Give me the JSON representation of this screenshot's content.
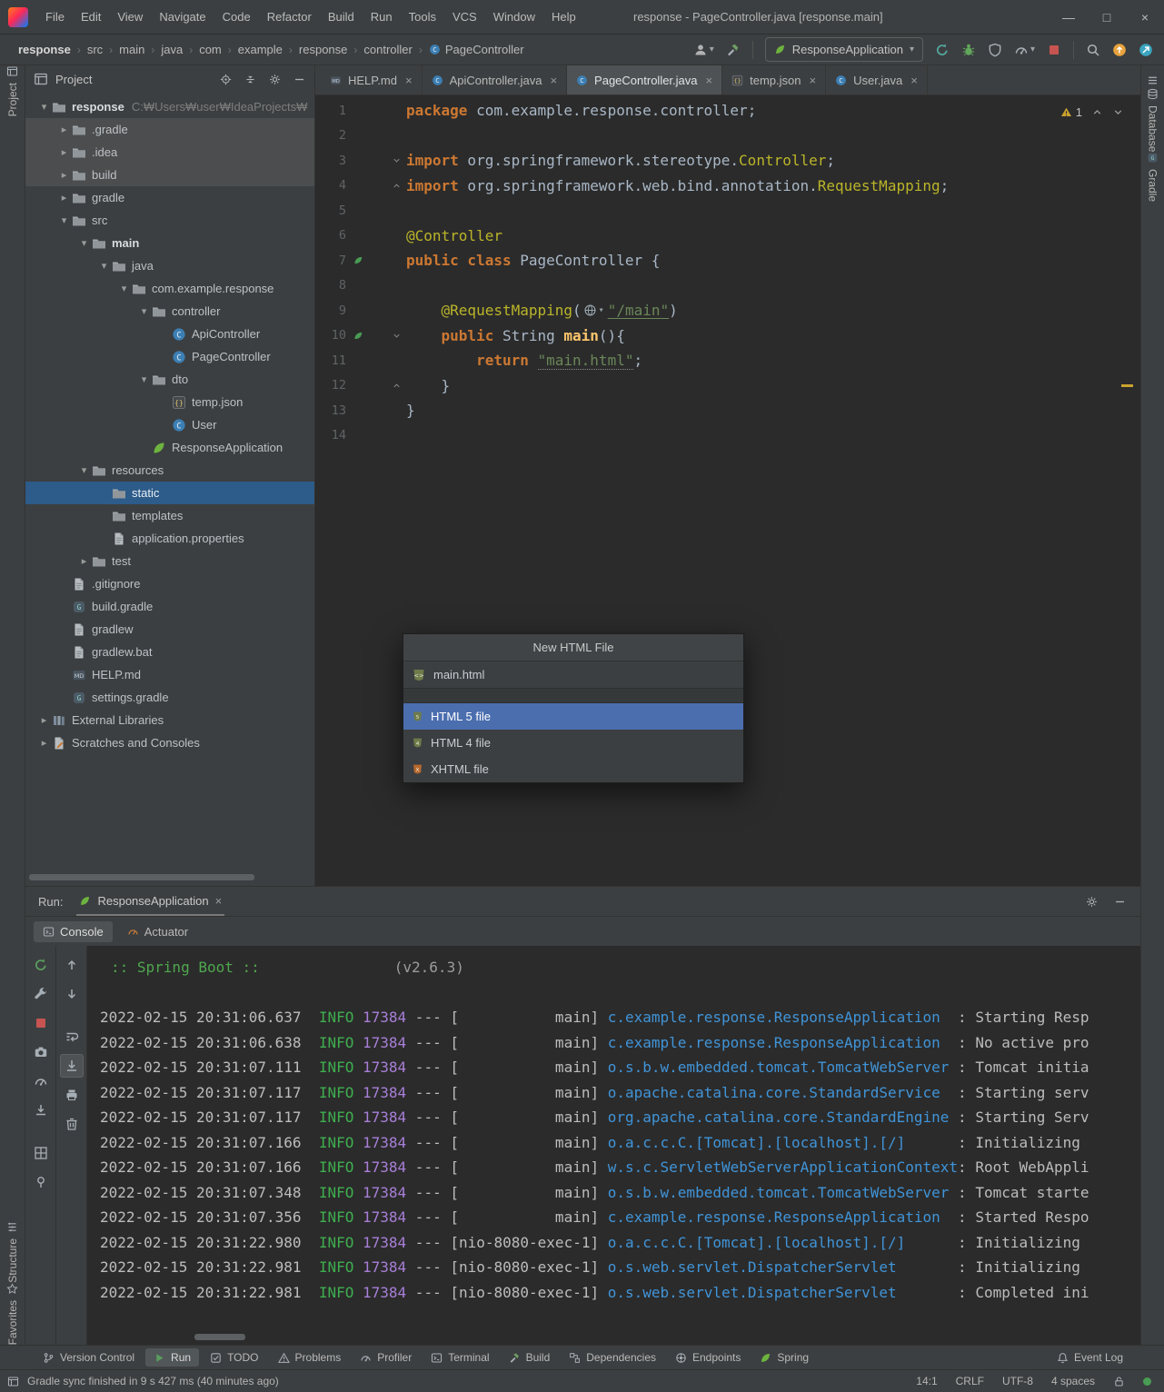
{
  "title_bar": {
    "menus": [
      "File",
      "Edit",
      "View",
      "Navigate",
      "Code",
      "Refactor",
      "Build",
      "Run",
      "Tools",
      "VCS",
      "Window",
      "Help"
    ],
    "title": "response - PageController.java [response.main]",
    "window_controls": {
      "minimize": "—",
      "maximize": "□",
      "close": "×"
    }
  },
  "nav_bar": {
    "breadcrumbs": [
      "response",
      "src",
      "main",
      "java",
      "com",
      "example",
      "response",
      "controller",
      "PageController"
    ],
    "left_actions": [
      {
        "icon": "user",
        "name": "user-menu",
        "chevron": true
      },
      {
        "icon": "hammer",
        "name": "build-project"
      }
    ],
    "run_config": {
      "icon": "spring",
      "label": "ResponseApplication"
    },
    "run_actions": [
      {
        "icon": "rerun",
        "name": "rerun-application"
      },
      {
        "icon": "bug",
        "name": "debug"
      },
      {
        "icon": "shield",
        "name": "run-with-coverage"
      },
      {
        "icon": "gauge",
        "name": "profiler",
        "chevron": true
      },
      {
        "icon": "stop",
        "name": "stop"
      }
    ],
    "far_actions": [
      {
        "icon": "search",
        "name": "search-everywhere"
      },
      {
        "icon": "circleUp",
        "name": "ide-update"
      },
      {
        "icon": "circleT",
        "name": "run-anything"
      }
    ]
  },
  "left_strip": {
    "top": [
      {
        "label": "Project",
        "icon": "projWin"
      }
    ],
    "bottom": [
      {
        "label": "Structure",
        "icon": "structure"
      },
      {
        "label": "Favorites",
        "icon": "star"
      }
    ]
  },
  "right_strip": {
    "top": [
      {
        "label": "Database",
        "icon": "db"
      },
      {
        "label": "Gradle",
        "icon": "gradleFile"
      }
    ]
  },
  "project_panel": {
    "title": "Project",
    "header_actions": [
      {
        "icon": "target",
        "name": "locate-file"
      },
      {
        "icon": "collapseAll",
        "name": "collapse-all"
      },
      {
        "icon": "gear",
        "name": "panel-settings"
      },
      {
        "icon": "minus",
        "name": "hide-panel"
      }
    ],
    "tree": [
      {
        "l": "response",
        "d": 0,
        "i": "folder",
        "a": "open",
        "bold": true,
        "extra": "C:₩Users₩user₩IdeaProjects₩"
      },
      {
        "l": ".gradle",
        "d": 1,
        "i": "folder",
        "a": "closed",
        "hl": true
      },
      {
        "l": ".idea",
        "d": 1,
        "i": "folder",
        "a": "closed",
        "hl": true
      },
      {
        "l": "build",
        "d": 1,
        "i": "folder",
        "a": "closed",
        "hl": true
      },
      {
        "l": "gradle",
        "d": 1,
        "i": "folder",
        "a": "closed"
      },
      {
        "l": "src",
        "d": 1,
        "i": "folder",
        "a": "open"
      },
      {
        "l": "main",
        "d": 2,
        "i": "folder",
        "a": "open",
        "bold": true
      },
      {
        "l": "java",
        "d": 3,
        "i": "folder",
        "a": "open"
      },
      {
        "l": "com.example.response",
        "d": 4,
        "i": "folder",
        "a": "open"
      },
      {
        "l": "controller",
        "d": 5,
        "i": "folder",
        "a": "open"
      },
      {
        "l": "ApiController",
        "d": 6,
        "i": "class"
      },
      {
        "l": "PageController",
        "d": 6,
        "i": "class"
      },
      {
        "l": "dto",
        "d": 5,
        "i": "folder",
        "a": "open"
      },
      {
        "l": "temp.json",
        "d": 6,
        "i": "json"
      },
      {
        "l": "User",
        "d": 6,
        "i": "class"
      },
      {
        "l": "ResponseApplication",
        "d": 5,
        "i": "spring"
      },
      {
        "l": "resources",
        "d": 2,
        "i": "folder",
        "a": "open"
      },
      {
        "l": "static",
        "d": 3,
        "i": "folder",
        "sel": true
      },
      {
        "l": "templates",
        "d": 3,
        "i": "folder"
      },
      {
        "l": "application.properties",
        "d": 3,
        "i": "file"
      },
      {
        "l": "test",
        "d": 2,
        "i": "folder",
        "a": "closed"
      },
      {
        "l": ".gitignore",
        "d": 1,
        "i": "file"
      },
      {
        "l": "build.gradle",
        "d": 1,
        "i": "gradleFile"
      },
      {
        "l": "gradlew",
        "d": 1,
        "i": "file"
      },
      {
        "l": "gradlew.bat",
        "d": 1,
        "i": "file"
      },
      {
        "l": "HELP.md",
        "d": 1,
        "i": "md"
      },
      {
        "l": "settings.gradle",
        "d": 1,
        "i": "gradleFile"
      },
      {
        "l": "External Libraries",
        "d": 0,
        "i": "lib",
        "a": "closed"
      },
      {
        "l": "Scratches and Consoles",
        "d": 0,
        "i": "scratch",
        "a": "closed"
      }
    ]
  },
  "editor": {
    "tabs": [
      {
        "label": "HELP.md",
        "icon": "md"
      },
      {
        "label": "ApiController.java",
        "icon": "class"
      },
      {
        "label": "PageController.java",
        "icon": "class",
        "active": true
      },
      {
        "label": "temp.json",
        "icon": "json"
      },
      {
        "label": "User.java",
        "icon": "class"
      }
    ],
    "warning_count": "1",
    "code": [
      {
        "n": 1,
        "t": [
          [
            "k",
            "package"
          ],
          [
            "p",
            " com.example.response.controller;"
          ]
        ]
      },
      {
        "n": 2,
        "t": []
      },
      {
        "n": 3,
        "f": "v",
        "t": [
          [
            "k",
            "import"
          ],
          [
            "p",
            " org.springframework.stereotype."
          ],
          [
            "a",
            "Controller"
          ],
          [
            "p",
            ";"
          ]
        ]
      },
      {
        "n": 4,
        "f": "^",
        "t": [
          [
            "k",
            "import"
          ],
          [
            "p",
            " org.springframework.web.bind.annotation."
          ],
          [
            "a",
            "RequestMapping"
          ],
          [
            "p",
            ";"
          ]
        ]
      },
      {
        "n": 5,
        "t": []
      },
      {
        "n": 6,
        "t": [
          [
            "a",
            "@Controller"
          ]
        ]
      },
      {
        "n": 7,
        "b": true,
        "t": [
          [
            "k",
            "public class"
          ],
          [
            "p",
            " PageController {"
          ]
        ]
      },
      {
        "n": 8,
        "t": []
      },
      {
        "n": 9,
        "t": [
          [
            "p",
            "    "
          ],
          [
            "a",
            "@RequestMapping"
          ],
          [
            "p",
            "("
          ],
          [
            "ic",
            "globe"
          ],
          [
            "sl",
            "\"/main\""
          ],
          [
            "p",
            ")"
          ]
        ]
      },
      {
        "n": 10,
        "b": true,
        "f": "v",
        "t": [
          [
            "p",
            "    "
          ],
          [
            "k",
            "public"
          ],
          [
            "p",
            " String "
          ],
          [
            "m",
            "main"
          ],
          [
            "p",
            "(){"
          ]
        ]
      },
      {
        "n": 11,
        "t": [
          [
            "p",
            "        "
          ],
          [
            "k",
            "return"
          ],
          [
            "p",
            " "
          ],
          [
            "su",
            "\"main.html\""
          ],
          [
            "p",
            ";"
          ]
        ]
      },
      {
        "n": 12,
        "f": "^",
        "t": [
          [
            "p",
            "    }"
          ]
        ]
      },
      {
        "n": 13,
        "t": [
          [
            "p",
            "}"
          ]
        ]
      },
      {
        "n": 14,
        "t": []
      }
    ]
  },
  "popup": {
    "title": "New HTML File",
    "file": {
      "label": "main.html",
      "icon": "html"
    },
    "types": [
      {
        "label": "HTML 5 file",
        "icon": "html5",
        "selected": true
      },
      {
        "label": "HTML 4 file",
        "icon": "html4"
      },
      {
        "label": "XHTML file",
        "icon": "xhtml"
      }
    ]
  },
  "run_panel": {
    "label": "Run:",
    "tab": "ResponseApplication",
    "tabs": [
      {
        "label": "Console",
        "icon": "terminal",
        "active": true
      },
      {
        "label": "Actuator",
        "icon": "actuator"
      }
    ],
    "header_actions": [
      {
        "icon": "gear",
        "name": "run-settings"
      },
      {
        "icon": "minus",
        "name": "minimize-run-panel"
      }
    ],
    "left_toolbar": [
      {
        "icon": "greenRerun",
        "name": "rerun-application"
      },
      {
        "icon": "wrench",
        "name": "edit-run-configuration"
      },
      {
        "icon": "stop",
        "name": "stop-process"
      },
      {
        "icon": "camera",
        "name": "thread-dump"
      },
      {
        "icon": "gauge",
        "name": "profiler-actions"
      },
      {
        "icon": "importArrow",
        "name": "import-thread-dump"
      },
      {
        "gap": true
      },
      {
        "icon": "grid",
        "name": "layout-settings"
      },
      {
        "icon": "pin",
        "name": "pin-tab"
      }
    ],
    "console_toolbar": [
      {
        "icon": "up",
        "name": "prev-occurrence"
      },
      {
        "icon": "down",
        "name": "next-occurrence"
      },
      {
        "gap": true
      },
      {
        "icon": "wrap",
        "name": "soft-wrap"
      },
      {
        "icon": "scrollEnd",
        "name": "scroll-to-end",
        "selected": true
      },
      {
        "icon": "printer",
        "name": "print-console"
      },
      {
        "icon": "trash",
        "name": "clear-console"
      }
    ],
    "banner": {
      "left": ":: Spring Boot ::",
      "right": "(v2.6.3)"
    },
    "lines": [
      {
        "time": "2022-02-15 20:31:06.637",
        "level": "INFO",
        "pid": "17384",
        "thread": "main",
        "logger": "c.example.response.ResponseApplication",
        "msg": "Starting Resp"
      },
      {
        "time": "2022-02-15 20:31:06.638",
        "level": "INFO",
        "pid": "17384",
        "thread": "main",
        "logger": "c.example.response.ResponseApplication",
        "msg": "No active pro"
      },
      {
        "time": "2022-02-15 20:31:07.111",
        "level": "INFO",
        "pid": "17384",
        "thread": "main",
        "logger": "o.s.b.w.embedded.tomcat.TomcatWebServer",
        "msg": "Tomcat initia"
      },
      {
        "time": "2022-02-15 20:31:07.117",
        "level": "INFO",
        "pid": "17384",
        "thread": "main",
        "logger": "o.apache.catalina.core.StandardService",
        "msg": "Starting serv"
      },
      {
        "time": "2022-02-15 20:31:07.117",
        "level": "INFO",
        "pid": "17384",
        "thread": "main",
        "logger": "org.apache.catalina.core.StandardEngine",
        "msg": "Starting Serv"
      },
      {
        "time": "2022-02-15 20:31:07.166",
        "level": "INFO",
        "pid": "17384",
        "thread": "main",
        "logger": "o.a.c.c.C.[Tomcat].[localhost].[/]",
        "msg": "Initializing"
      },
      {
        "time": "2022-02-15 20:31:07.166",
        "level": "INFO",
        "pid": "17384",
        "thread": "main",
        "logger": "w.s.c.ServletWebServerApplicationContext",
        "msg": "Root WebAppli"
      },
      {
        "time": "2022-02-15 20:31:07.348",
        "level": "INFO",
        "pid": "17384",
        "thread": "main",
        "logger": "o.s.b.w.embedded.tomcat.TomcatWebServer",
        "msg": "Tomcat starte"
      },
      {
        "time": "2022-02-15 20:31:07.356",
        "level": "INFO",
        "pid": "17384",
        "thread": "main",
        "logger": "c.example.response.ResponseApplication",
        "msg": "Started Respo"
      },
      {
        "time": "2022-02-15 20:31:22.980",
        "level": "INFO",
        "pid": "17384",
        "thread": "nio-8080-exec-1",
        "logger": "o.a.c.c.C.[Tomcat].[localhost].[/]",
        "msg": "Initializing"
      },
      {
        "time": "2022-02-15 20:31:22.981",
        "level": "INFO",
        "pid": "17384",
        "thread": "nio-8080-exec-1",
        "logger": "o.s.web.servlet.DispatcherServlet",
        "msg": "Initializing"
      },
      {
        "time": "2022-02-15 20:31:22.981",
        "level": "INFO",
        "pid": "17384",
        "thread": "nio-8080-exec-1",
        "logger": "o.s.web.servlet.DispatcherServlet",
        "msg": "Completed ini"
      }
    ]
  },
  "bottom_bar": {
    "tools": [
      {
        "label": "Version Control",
        "icon": "branch"
      },
      {
        "label": "Run",
        "icon": "play",
        "active": true
      },
      {
        "label": "TODO",
        "icon": "todo"
      },
      {
        "label": "Problems",
        "icon": "problems"
      },
      {
        "label": "Profiler",
        "icon": "gauge"
      },
      {
        "label": "Terminal",
        "icon": "terminal"
      },
      {
        "label": "Build",
        "icon": "hammer"
      },
      {
        "label": "Dependencies",
        "icon": "deps"
      },
      {
        "label": "Endpoints",
        "icon": "endpoints"
      },
      {
        "label": "Spring",
        "icon": "spring"
      }
    ],
    "tools_right": [
      {
        "label": "Event Log",
        "icon": "bell"
      }
    ]
  },
  "status_bar": {
    "message": "Gradle sync finished in 9 s 427 ms (40 minutes ago)",
    "items": [
      {
        "label": "14:1",
        "name": "caret-position"
      },
      {
        "label": "CRLF",
        "name": "line-separator"
      },
      {
        "label": "UTF-8",
        "name": "file-encoding"
      },
      {
        "label": "4 spaces",
        "name": "indent-size"
      }
    ]
  }
}
